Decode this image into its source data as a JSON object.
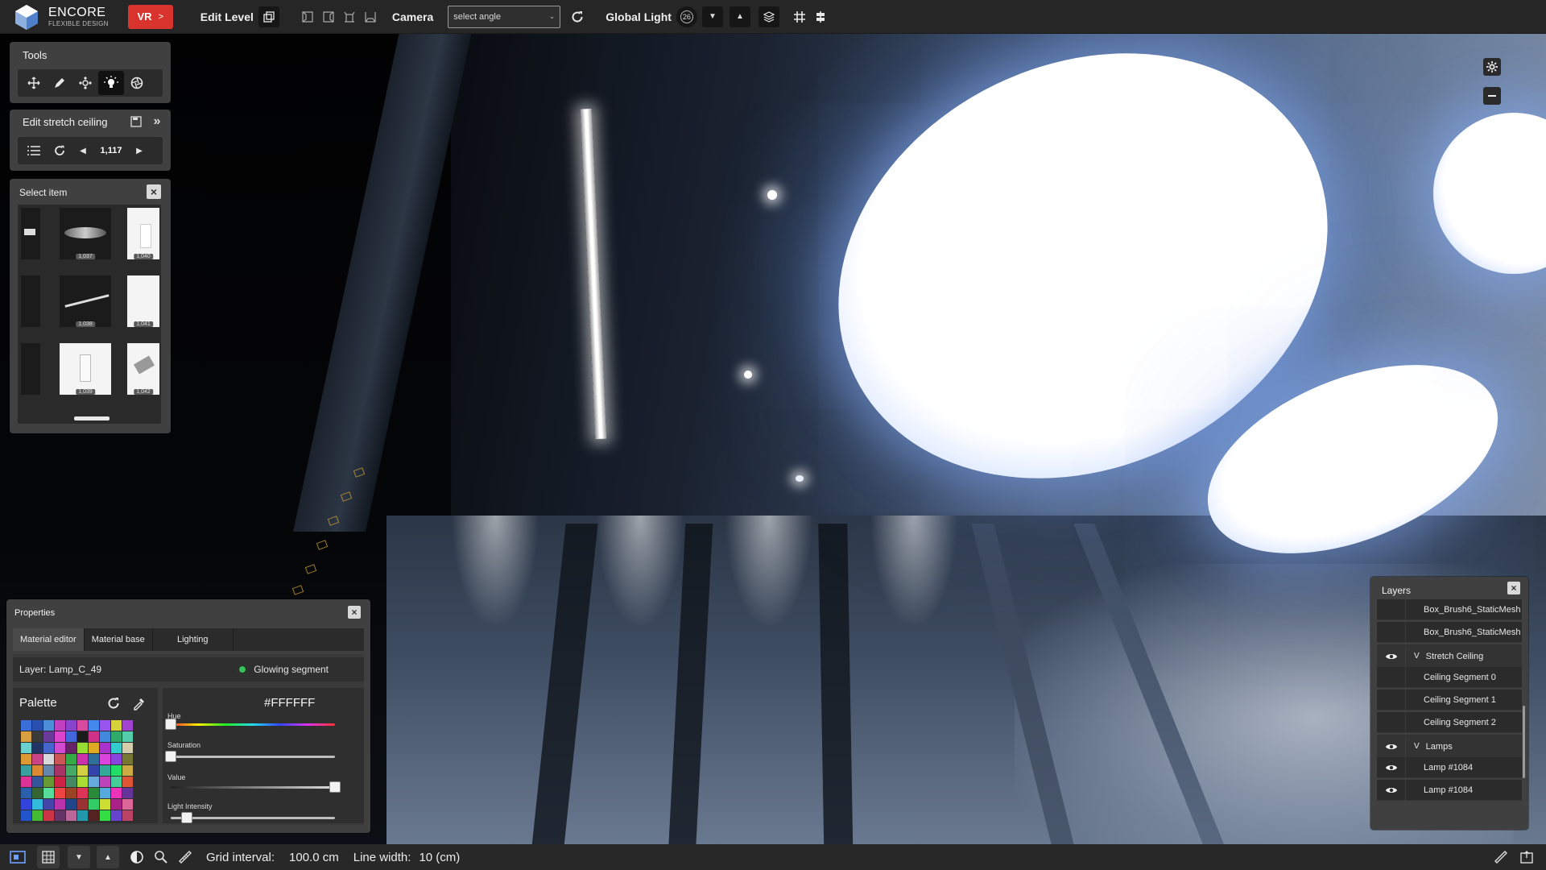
{
  "app": {
    "name": "ENCORE",
    "tagline": "FLEXIBLE DESIGN",
    "vr_label": "VR",
    "vr_arrow": ">"
  },
  "toolbar": {
    "edit_level_label": "Edit Level",
    "camera_label": "Camera",
    "angle_select_value": "select angle",
    "global_light_label": "Global Light",
    "global_light_value": "26"
  },
  "tools_panel": {
    "title": "Tools",
    "tools": [
      "move-icon",
      "pencil-icon",
      "group-icon",
      "light-bulb-icon",
      "aperture-icon"
    ],
    "active_tool": "light-bulb-icon"
  },
  "edit_panel": {
    "title": "Edit stretch ceiling",
    "counter_value": "1,117"
  },
  "select_item": {
    "title": "Select item",
    "items": [
      "1,037",
      "1,040",
      "1,038",
      "1,041",
      "1,039",
      "1,042"
    ]
  },
  "properties": {
    "title": "Properties",
    "tabs": [
      "Material editor",
      "Material base",
      "Lighting"
    ],
    "active_tab": "Material editor",
    "layer_label": "Layer: Lamp_C_49",
    "glowing_label": "Glowing segment",
    "palette_label": "Palette",
    "hex_value": "#FFFFFF",
    "sliders": [
      {
        "label": "Hue",
        "value": 0.0
      },
      {
        "label": "Saturation",
        "value": 0.0
      },
      {
        "label": "Value",
        "value": 1.0
      },
      {
        "label": "Light Intensity",
        "value": 0.1
      }
    ],
    "palette_colors": [
      "#3a6fd8",
      "#2b4fb0",
      "#4d8fd6",
      "#c040c0",
      "#8844cc",
      "#d84aa0",
      "#4488ee",
      "#9a55ee",
      "#d6d23c",
      "#a044d0",
      "#d8a040",
      "#3a3a3a",
      "#6a3a9a",
      "#dd44cc",
      "#4466dd",
      "#1c1c1c",
      "#cc3388",
      "#4488dd",
      "#2faa6a",
      "#55ccaa",
      "#6ad0d0",
      "#223366",
      "#4466cc",
      "#d04bd0",
      "#662266",
      "#99dd33",
      "#ddaa22",
      "#aa33cc",
      "#33cccc",
      "#d4ccaa",
      "#dd9933",
      "#cc4488",
      "#d8d8d8",
      "#cc5555",
      "#33aa44",
      "#cc33aa",
      "#2e6f9a",
      "#dd44dd",
      "#8844dd",
      "#777733",
      "#3a9f9f",
      "#dd8833",
      "#6688aa",
      "#aa3366",
      "#44aa66",
      "#d4d044",
      "#3344aa",
      "#33aa99",
      "#22dd66",
      "#ccaa44",
      "#dd3399",
      "#335599",
      "#669933",
      "#cc2244",
      "#448866",
      "#aadd33",
      "#66aadd",
      "#bb44bb",
      "#44cc99",
      "#dd5533",
      "#2a5faa",
      "#336633",
      "#55dd99",
      "#ee4444",
      "#994422",
      "#dd3355",
      "#2a8a3a",
      "#55aadd",
      "#ee33bb",
      "#663399",
      "#3344dd",
      "#33bbdd",
      "#4444aa",
      "#bb33aa",
      "#224488",
      "#993333",
      "#33cc66",
      "#ccdd33",
      "#aa2288",
      "#dd6699",
      "#2255cc",
      "#44bb33",
      "#cc3344",
      "#663366",
      "#bb6699",
      "#2299aa",
      "#552222",
      "#33dd44",
      "#6644cc",
      "#bb4466"
    ]
  },
  "layers": {
    "title": "Layers",
    "rows": [
      {
        "label": "Box_Brush6_StaticMesh",
        "visible": false,
        "expander": ""
      },
      {
        "label": "Box_Brush6_StaticMesh",
        "visible": false,
        "expander": ""
      },
      {
        "label": "Stretch Ceiling",
        "visible": true,
        "expander": "V"
      },
      {
        "label": "Ceiling Segment 0",
        "visible": false,
        "expander": ""
      },
      {
        "label": "Ceiling Segment 1",
        "visible": false,
        "expander": ""
      },
      {
        "label": "Ceiling Segment 2",
        "visible": false,
        "expander": ""
      },
      {
        "label": "Lamps",
        "visible": true,
        "expander": "V"
      },
      {
        "label": "Lamp #1084",
        "visible": true,
        "expander": ""
      },
      {
        "label": "Lamp #1084",
        "visible": true,
        "expander": ""
      }
    ]
  },
  "statusbar": {
    "grid_label": "Grid interval:",
    "grid_value": "100.0 cm",
    "line_label": "Line width:",
    "line_value": "10 (cm)"
  }
}
